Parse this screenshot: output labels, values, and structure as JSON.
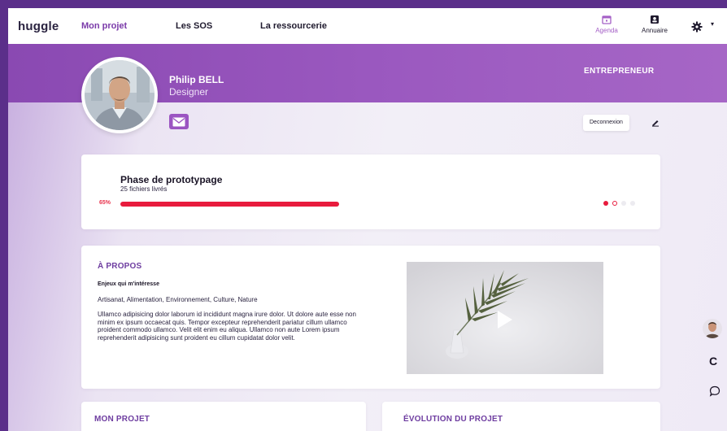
{
  "nav": {
    "logo": "huggle",
    "links": [
      "Mon projet",
      "Les SOS",
      "La ressourcerie"
    ],
    "agenda_label": "Agenda",
    "annuaire_label": "Annuaire",
    "agenda_icon": "calendar-icon",
    "annuaire_icon": "contact-card-icon",
    "settings_icon": "gear-icon"
  },
  "profile": {
    "name": "Philip BELL",
    "role": "Designer",
    "badge": "ENTREPRENEUR",
    "logout_label": "Deconnexion",
    "mail_icon": "mail-icon",
    "edit_icon": "pencil-icon"
  },
  "phase": {
    "title": "Phase de prototypage",
    "subtitle": "25 fichiers livrés",
    "percent_label": "65%",
    "progress": 0.65,
    "active_step": 1,
    "steps": 4
  },
  "about": {
    "title": "À PROPOS",
    "label": "Enjeux qui m'intéresse",
    "tags": "Artisanat, Alimentation, Environnement, Culture, Nature",
    "text": "Ullamco adipisicing dolor laborum id incididunt magna irure dolor. Ut dolore aute esse non minim ex ipsum occaecat quis. Tempor excepteur reprehenderit pariatur cillum ullamco proident commodo ullamco. Velit elit enim eu aliqua. Ullamco non aute Lorem ipsum reprehenderit adipisicing sunt proident eu cillum cupidatat dolor velit."
  },
  "sections": {
    "projet_title": "MON PROJET",
    "evolution_title": "ÉVOLUTION DU PROJET"
  },
  "floating": {
    "letter": "C",
    "chat_icon": "chat-bubble-icon"
  },
  "colors": {
    "brand": "#8a49b2",
    "accent": "#e81b3d",
    "section_title": "#6e3da0"
  }
}
